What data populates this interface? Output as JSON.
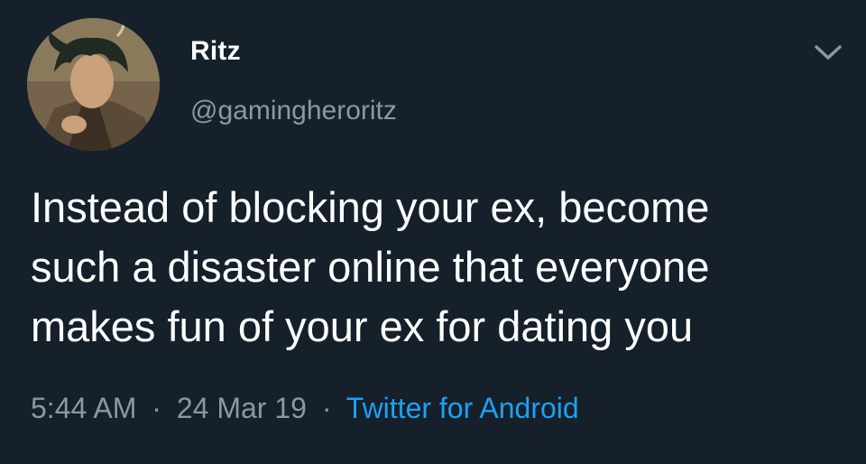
{
  "tweet": {
    "display_name": "Ritz",
    "handle": "@gamingheroritz",
    "text_lines": [
      "Instead of blocking your ex, become",
      "such a disaster online that everyone",
      "makes fun of your ex for dating you"
    ],
    "time": "5:44 AM",
    "separator": "·",
    "date": "24 Mar 19",
    "source": "Twitter for Android"
  },
  "icons": {
    "avatar": "profile-picture",
    "menu": "chevron-down-icon"
  },
  "colors": {
    "background": "#15202b",
    "primary_text": "#ffffff",
    "secondary_text": "#8899a6",
    "link": "#1da1f2"
  }
}
